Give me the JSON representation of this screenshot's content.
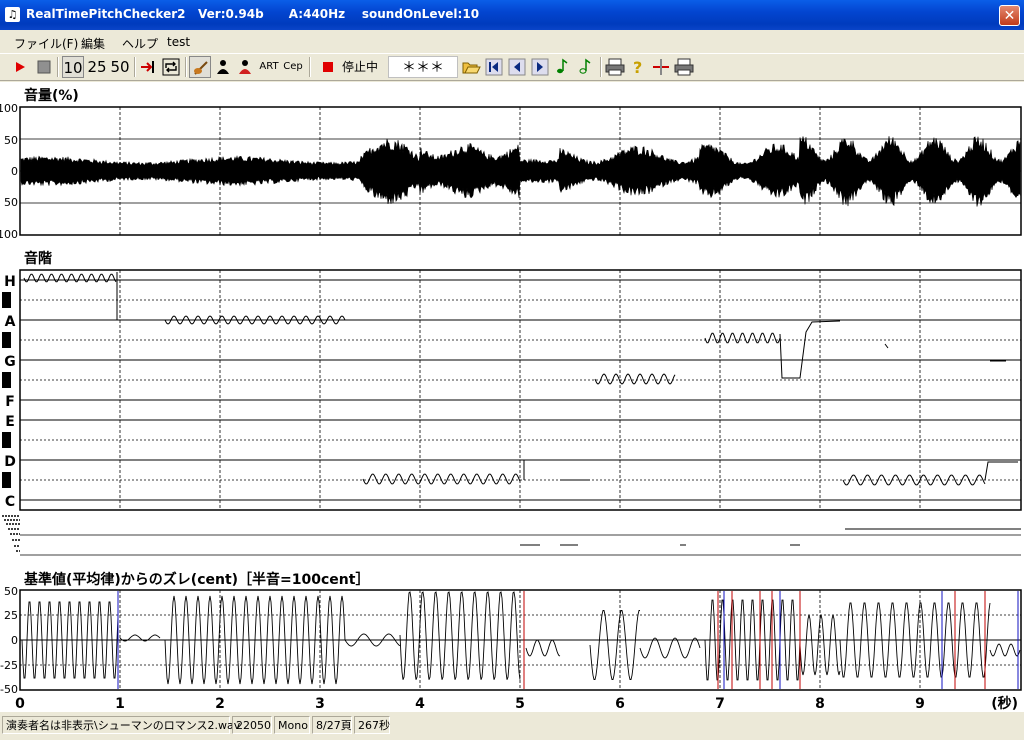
{
  "window": {
    "title": "RealTimePitchChecker2   Ver:0.94b      A:440Hz    soundOnLevel:10",
    "close": "✕"
  },
  "menu": [
    "ファイル(F)",
    "編集",
    "ヘルプ",
    "test"
  ],
  "toolbar": {
    "range_buttons": [
      "10",
      "25",
      "50"
    ],
    "art_label": "ART",
    "cep_label": "Cep",
    "status": "停止中",
    "note_display": "＊＊＊"
  },
  "panels": {
    "volume": {
      "title": "音量(%)",
      "ticks": [
        "100",
        "50",
        "0",
        "50",
        "100"
      ]
    },
    "pitch": {
      "title": "音階",
      "notes": [
        "H",
        "A",
        "G",
        "F",
        "E",
        "D",
        "C"
      ]
    },
    "cent": {
      "title": "基準値(平均律)からのズレ(cent)［半音=100cent］",
      "ticks": [
        "50",
        "25",
        "0",
        "-25",
        "-50"
      ]
    },
    "time_axis": {
      "labels": [
        "0",
        "1",
        "2",
        "3",
        "4",
        "5",
        "6",
        "7",
        "8",
        "9"
      ],
      "unit": "(秒)"
    }
  },
  "status": {
    "file": "演奏者名は非表示\\シューマンのロマンス2.wav",
    "rate": "22050",
    "channels": "Mono",
    "page": "8/27頁",
    "duration": "267秒"
  },
  "colors": {
    "titlebar": "#0a5ee8",
    "close": "#c23b1a",
    "trace": "#000000",
    "onset_red": "#c00000",
    "onset_blue": "#1010c0"
  }
}
